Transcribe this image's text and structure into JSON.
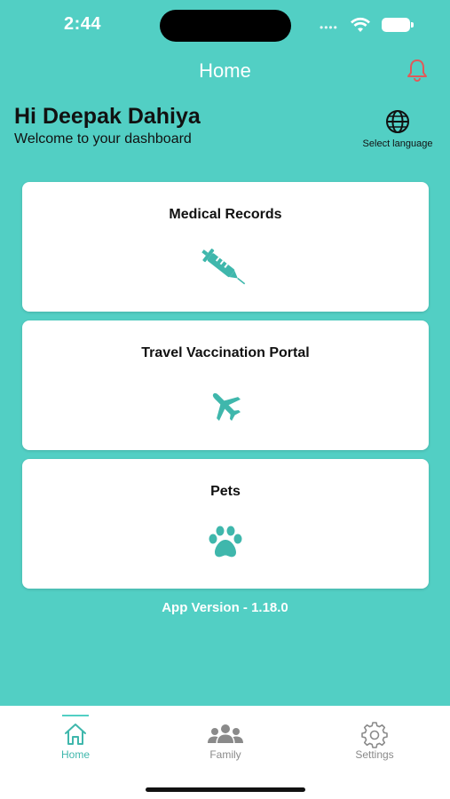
{
  "status": {
    "time": "2:44"
  },
  "header": {
    "title": "Home",
    "bell_icon": "bell-icon"
  },
  "greeting": {
    "name": "Hi Deepak Dahiya",
    "subtitle": "Welcome to your dashboard"
  },
  "language": {
    "label": "Select language",
    "icon": "globe-icon"
  },
  "cards": [
    {
      "title": "Medical Records",
      "icon": "syringe-icon"
    },
    {
      "title": "Travel Vaccination Portal",
      "icon": "airplane-icon"
    },
    {
      "title": "Pets",
      "icon": "paw-icon"
    }
  ],
  "version": "App Version - 1.18.0",
  "tabs": [
    {
      "label": "Home",
      "icon": "home-icon",
      "active": true
    },
    {
      "label": "Family",
      "icon": "family-icon",
      "active": false
    },
    {
      "label": "Settings",
      "icon": "gear-icon",
      "active": false
    }
  ],
  "colors": {
    "background": "#52cfc4",
    "accent": "#3fb7ac",
    "bell": "#e05a5a"
  }
}
